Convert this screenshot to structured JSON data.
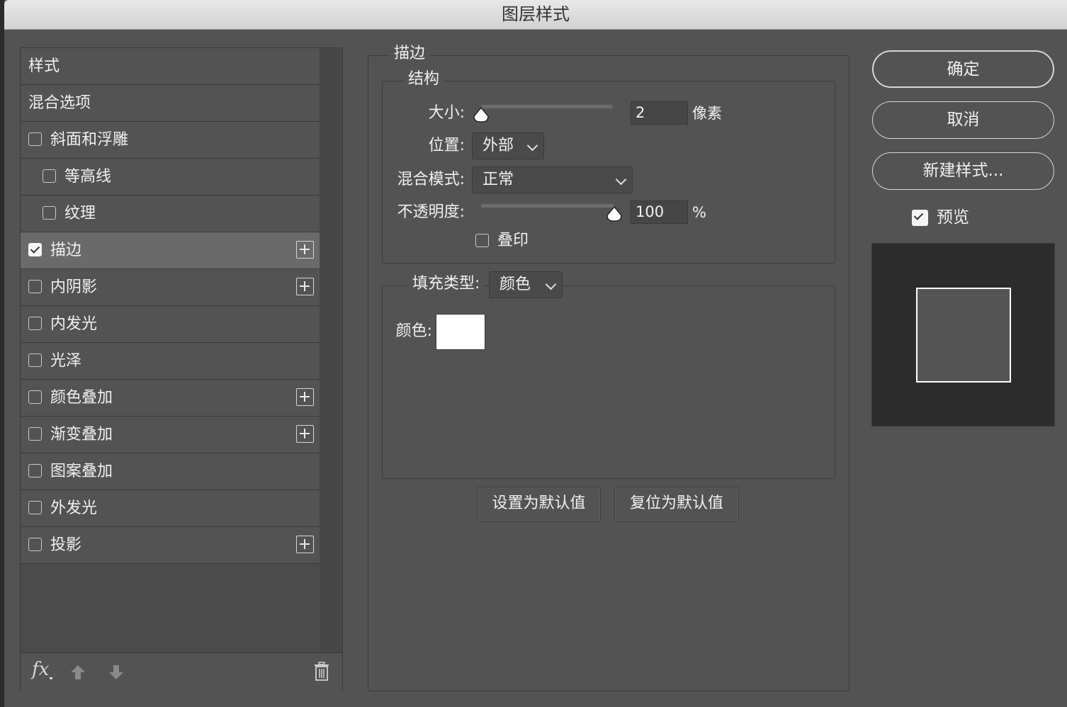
{
  "window": {
    "title": "图层样式"
  },
  "style_list": {
    "items": [
      {
        "label": "样式",
        "kind": "plain"
      },
      {
        "label": "混合选项",
        "kind": "plain"
      },
      {
        "label": "斜面和浮雕",
        "kind": "checkbox",
        "checked": false,
        "has_add": false
      },
      {
        "label": "等高线",
        "kind": "sub",
        "checked": false,
        "has_add": false
      },
      {
        "label": "纹理",
        "kind": "sub",
        "checked": false,
        "has_add": false
      },
      {
        "label": "描边",
        "kind": "checkbox",
        "checked": true,
        "has_add": true,
        "selected": true
      },
      {
        "label": "内阴影",
        "kind": "checkbox",
        "checked": false,
        "has_add": true
      },
      {
        "label": "内发光",
        "kind": "checkbox",
        "checked": false,
        "has_add": false
      },
      {
        "label": "光泽",
        "kind": "checkbox",
        "checked": false,
        "has_add": false
      },
      {
        "label": "颜色叠加",
        "kind": "checkbox",
        "checked": false,
        "has_add": true
      },
      {
        "label": "渐变叠加",
        "kind": "checkbox",
        "checked": false,
        "has_add": true
      },
      {
        "label": "图案叠加",
        "kind": "checkbox",
        "checked": false,
        "has_add": false
      },
      {
        "label": "外发光",
        "kind": "checkbox",
        "checked": false,
        "has_add": false
      },
      {
        "label": "投影",
        "kind": "checkbox",
        "checked": false,
        "has_add": true
      }
    ],
    "footer": {
      "fx_label": "fx"
    }
  },
  "stroke": {
    "group_title": "描边",
    "structure_title": "结构",
    "size_label": "大小:",
    "size_value": "2",
    "size_unit": "像素",
    "size_slider_fraction": 0.0,
    "position_label": "位置:",
    "position_value": "外部",
    "blend_label": "混合模式:",
    "blend_value": "正常",
    "opacity_label": "不透明度:",
    "opacity_value": "100",
    "opacity_unit": "%",
    "opacity_slider_fraction": 1.0,
    "overprint_label": "叠印",
    "overprint_checked": false,
    "fill_type_label": "填充类型:",
    "fill_type_value": "颜色",
    "color_label": "颜色:",
    "color_value": "#ffffff",
    "make_default_label": "设置为默认值",
    "reset_default_label": "复位为默认值"
  },
  "actions": {
    "ok_label": "确定",
    "cancel_label": "取消",
    "new_style_label": "新建样式...",
    "preview_label": "预览",
    "preview_checked": true
  },
  "colors": {
    "panel_bg": "#535353",
    "selected_row": "#6a6a6a",
    "stroke_color": "#ffffff",
    "preview_bg": "#2c2c2c"
  }
}
